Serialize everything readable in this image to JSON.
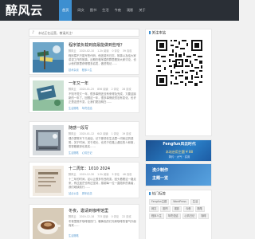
{
  "header": {
    "logo": "醉风云",
    "nav": [
      "首页",
      "网文",
      "图书",
      "生活",
      "今夜",
      "观影",
      "关于"
    ],
    "active_index": 0
  },
  "notice": {
    "text": "本站正在运营，敬请关注！"
  },
  "posts": [
    {
      "title": "程序猿负载到底最能做到些啥？",
      "author": "醉风云",
      "date": "2020-02-10",
      "views": "1.2k 阅读",
      "comments": "0 评论",
      "likes": "39 喜欢",
      "excerpt": "程序猿不只能写些代码，他还能写日志、故事以及给大家讲讲工作的故事。近期在程序猿的群里看到大家讨论，也从他们那里获得很多启发，做些笔记……",
      "tags": [
        "技术杂谈",
        "程序人生"
      ]
    },
    {
      "title": "一年又一年",
      "author": "醉风云",
      "date": "2020-01-25",
      "views": "856 阅读",
      "comments": "2 评论",
      "likes": "28 喜欢",
      "excerpt": "不知不觉又一年，很多事情还没有来得及完成，又要迎接新的一年了。回想这一年，很多事情依然没有变化，也许正是这些不变，让我们更加明白……",
      "tags": [
        "生活随笔",
        "年终总结"
      ]
    },
    {
      "title": "随感一段写",
      "author": "醉风云",
      "date": "2020-01-12",
      "views": "642 阅读",
      "comments": "1 评论",
      "likes": "19 喜欢",
      "excerpt": "偶尔提笔写下几段话，记下那些在生活里一闪而过的感受，关于时间、关于成长、也关于在路上遇见的人和事，零零散散却也真实……",
      "tags": [
        "生活随笔",
        "心情日记"
      ]
    },
    {
      "title": "十二周年：1010 2024",
      "author": "醉风云",
      "date": "2019-12-30",
      "views": "1.5k 阅读",
      "comments": "5 评论",
      "likes": "46 喜欢",
      "excerpt": "十二年的时间，足以让很多东西改变。回头看看这一路走来，有过迷茫也有过坚持，感谢每一位一直陪伴的读者，我们继续前行……",
      "tags": [
        "站点公告",
        "周年纪念"
      ]
    },
    {
      "title": "冬夜，邀请到咖啡馆里",
      "author": "醉风云",
      "date": "2019-12-18",
      "views": "733 阅读",
      "comments": "0 评论",
      "likes": "22 喜欢",
      "excerpt": "冬夜里推开咖啡馆的门，暖黄色的灯光和咖啡的香气扑面而来……",
      "tags": [
        "生活随笔"
      ]
    }
  ],
  "sidebar": {
    "follow_title": "关注本站",
    "banner1": {
      "title": "Fengfun风云时代",
      "sub": "本站启用主题 ¥ 88",
      "sub2": "简约 · 大气 · 实用"
    },
    "banner2": {
      "line1": "洗少制作",
      "line2": "主题一览"
    },
    "tags_title": "热门标签",
    "tags": [
      "Fengfun主题",
      "WordPress",
      "生活",
      "网文",
      "图书",
      "观影",
      "今夜",
      "随笔",
      "程序人生",
      "年终总结",
      "心情日记",
      "咖啡"
    ]
  },
  "colors": {
    "header_bg": "#2a2f36",
    "accent": "#3d8fd0",
    "page_bg": "#f1f1f1"
  },
  "icons": {
    "notice": "speaker-icon"
  }
}
